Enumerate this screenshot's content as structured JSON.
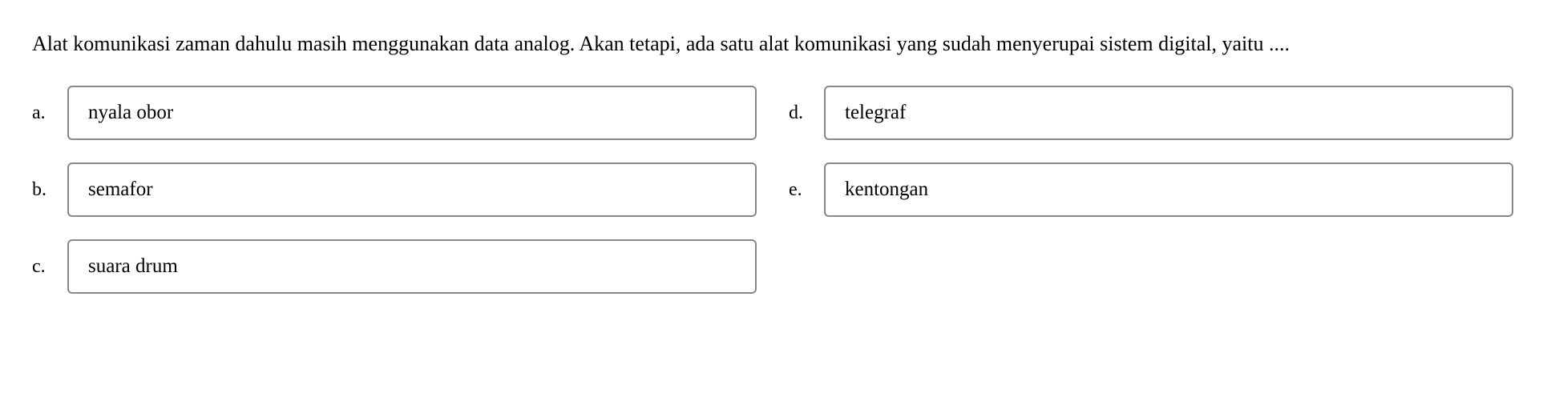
{
  "question": {
    "text": "Alat komunikasi zaman dahulu masih menggunakan data  analog. Akan tetapi, ada satu alat komunikasi yang sudah menyerupai sistem digital, yaitu ...."
  },
  "options": {
    "a": {
      "letter": "a.",
      "text": "nyala obor"
    },
    "b": {
      "letter": "b.",
      "text": "semafor"
    },
    "c": {
      "letter": "c.",
      "text": "suara drum"
    },
    "d": {
      "letter": "d.",
      "text": "telegraf"
    },
    "e": {
      "letter": "e.",
      "text": "kentongan"
    }
  }
}
